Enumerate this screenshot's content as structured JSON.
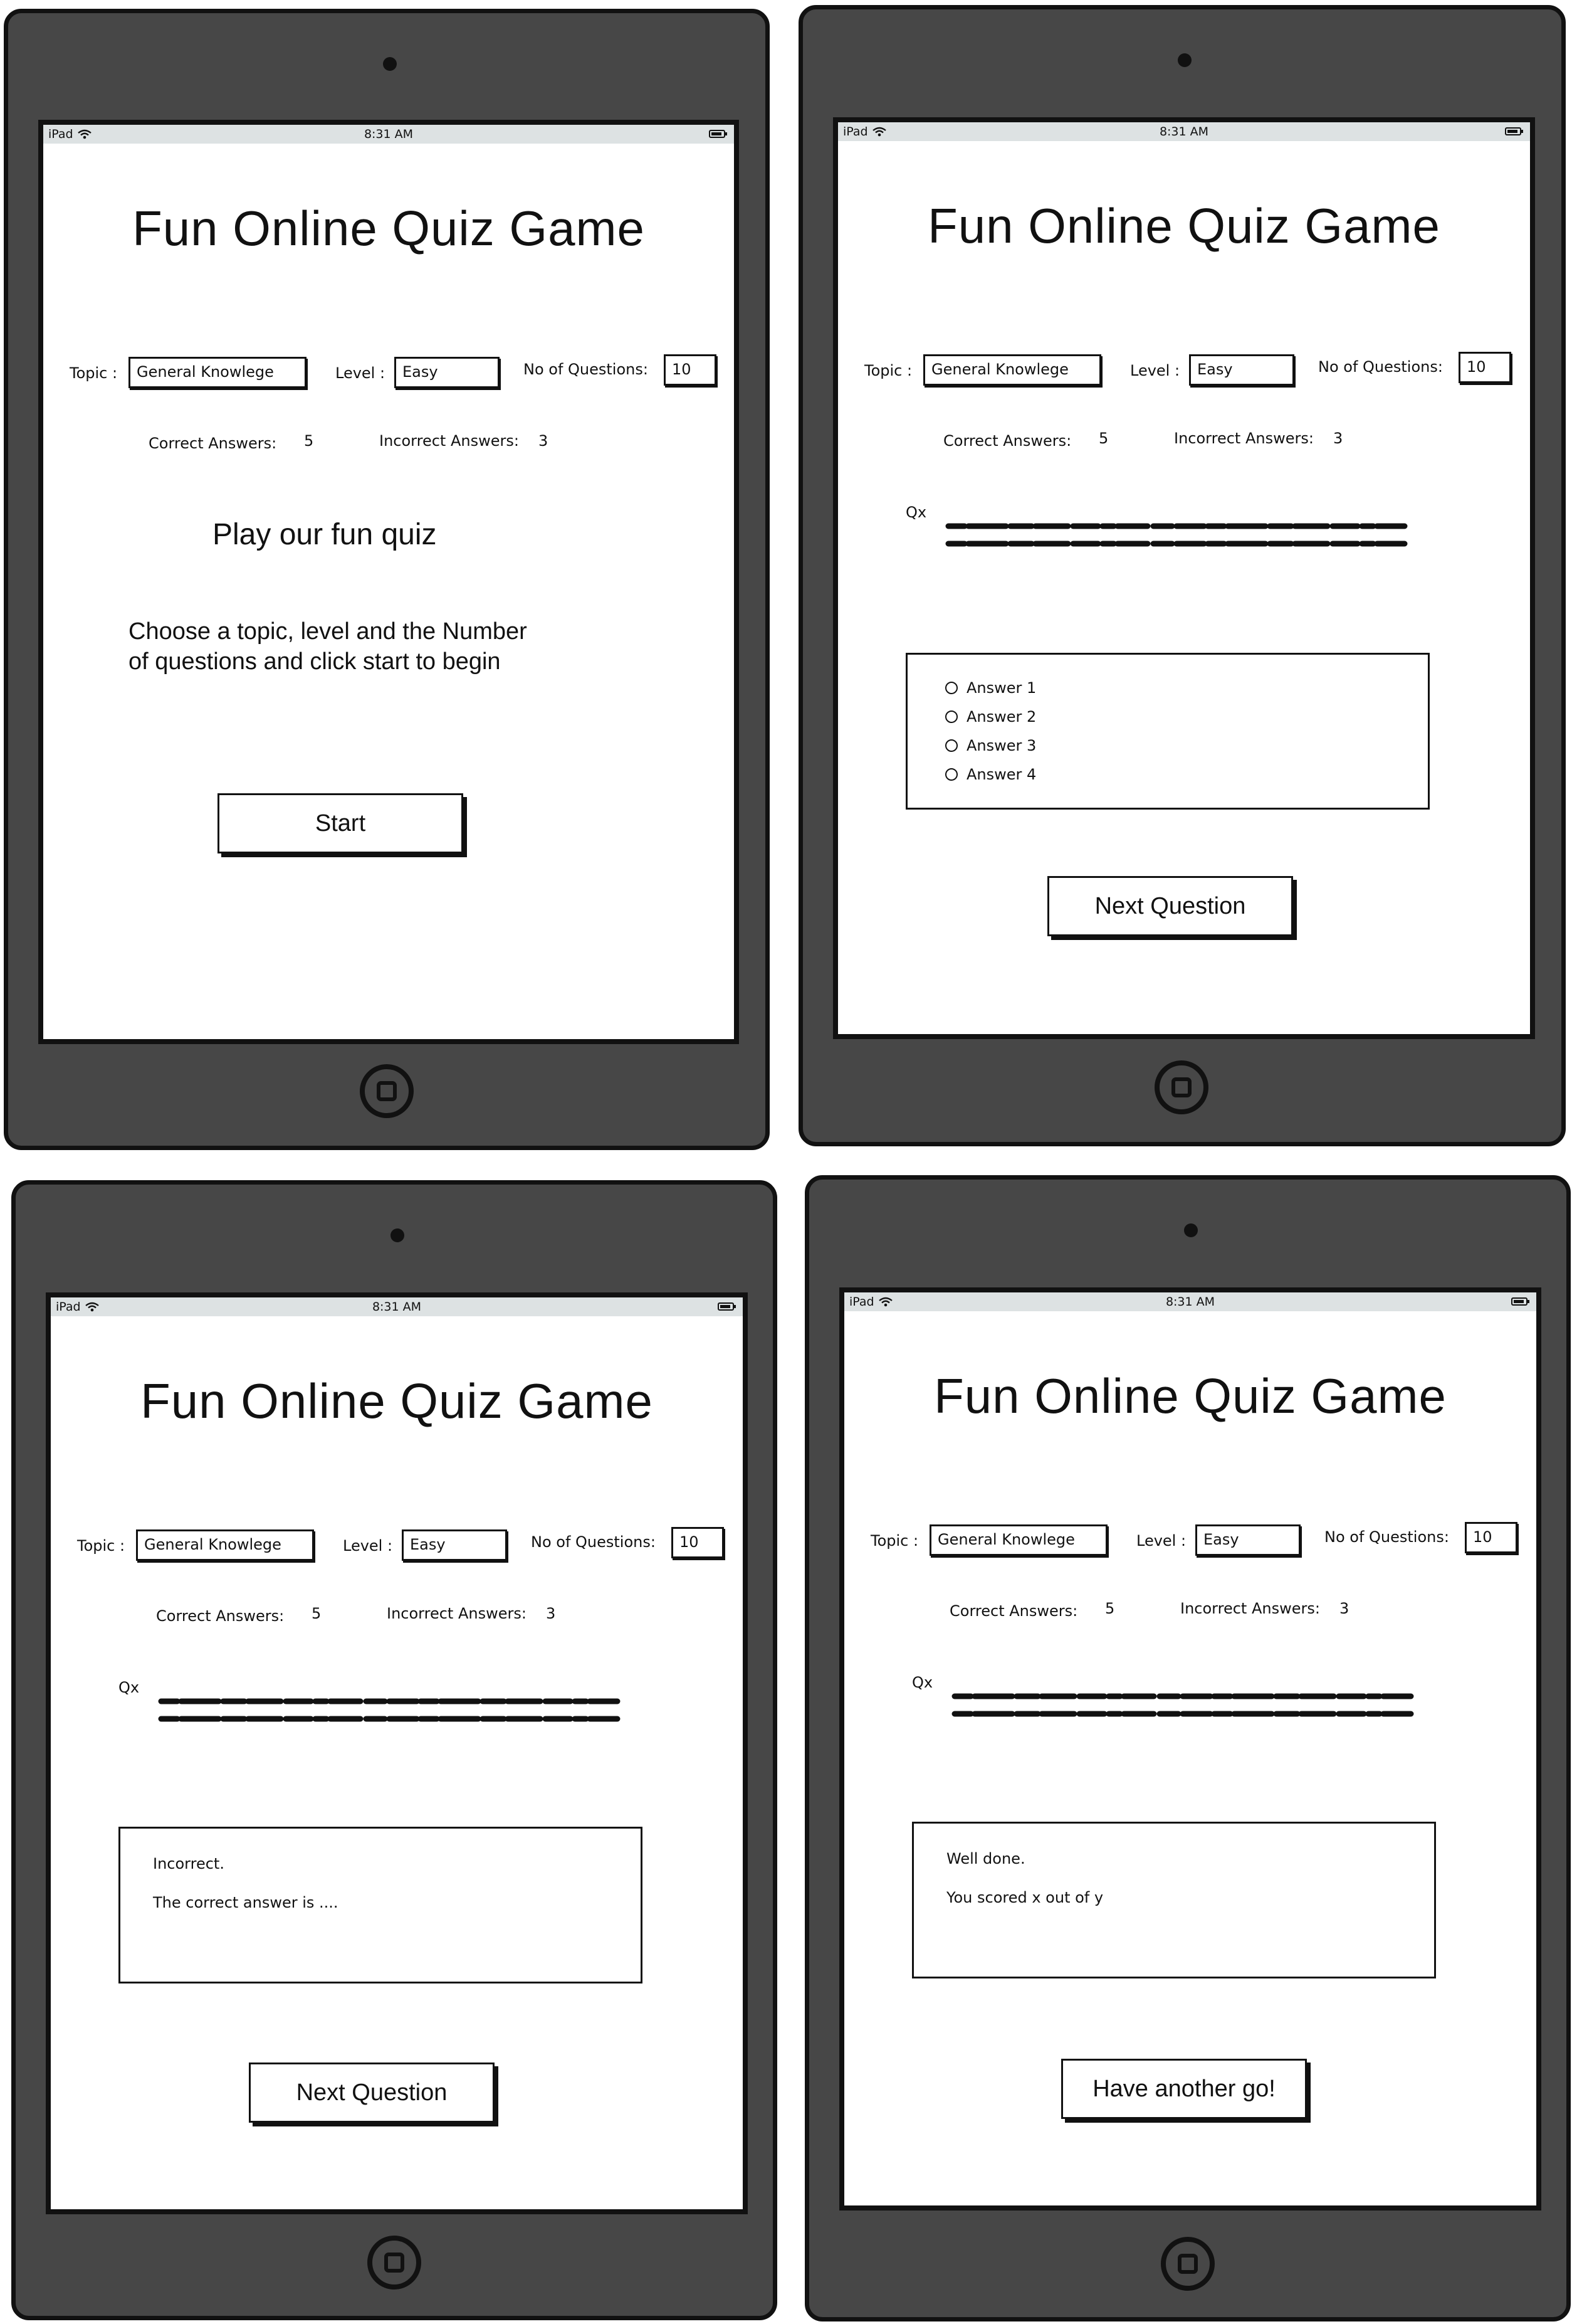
{
  "statusbar": {
    "carrier": "iPad",
    "time": "8:31 AM"
  },
  "app": {
    "title": "Fun Online Quiz Game",
    "topic_label": "Topic :",
    "topic_value": "General Knowlege",
    "level_label": "Level :",
    "level_value": "Easy",
    "questions_label": "No of Questions:",
    "questions_value": "10",
    "correct_label": "Correct Answers:",
    "correct_value": "5",
    "incorrect_label": "Incorrect Answers:",
    "incorrect_value": "3",
    "question_label": "Qx"
  },
  "screen1": {
    "heading": "Play our fun quiz",
    "instructions_line1": "Choose a topic, level and the Number",
    "instructions_line2": "of questions and click start to begin",
    "start_button": "Start"
  },
  "screen2": {
    "answers": [
      "Answer 1",
      "Answer 2",
      "Answer 3",
      "Answer 4"
    ],
    "next_button": "Next Question"
  },
  "screen3": {
    "result": "Incorrect.",
    "correct_answer_text": "The correct answer is ....",
    "next_button": "Next Question"
  },
  "screen4": {
    "result": "Well done.",
    "score_text": "You scored x out of y",
    "again_button": "Have another go!"
  },
  "colors": {
    "device": "#474747",
    "statusbar": "#dde2e3",
    "outline": "#111111"
  }
}
